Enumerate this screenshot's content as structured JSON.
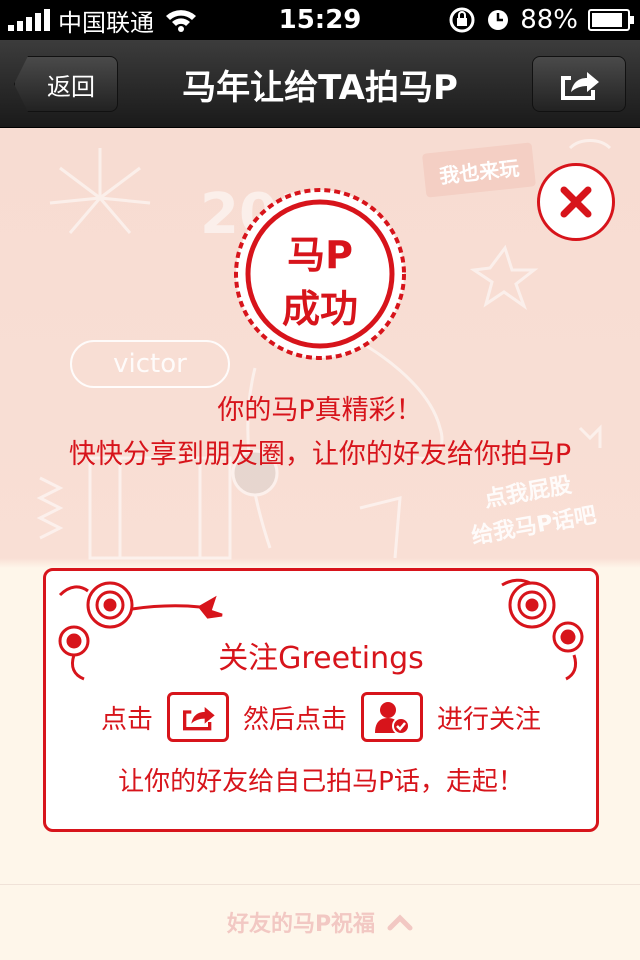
{
  "status_bar": {
    "carrier": "中国联通",
    "time": "15:29",
    "battery": "88%",
    "battery_level": 0.88
  },
  "nav": {
    "back_label": "返回",
    "title": "马年让给TA拍马P",
    "share_icon": "share-icon"
  },
  "background": {
    "play_too": "我也来玩",
    "year": "2014",
    "name_bubble": "victor",
    "poke_line1": "点我屁股",
    "poke_line2": "给我马P话吧"
  },
  "stamp": {
    "line1": "马P",
    "line2": "成功"
  },
  "message": {
    "line1": "你的马P真精彩！",
    "line2": "快快分享到朋友圈，让你的好友给你拍马P"
  },
  "follow_card": {
    "title": "关注Greetings",
    "step1": "点击",
    "step2": "然后点击",
    "step3": "进行关注",
    "footer": "让你的好友给自己拍马P话，走起！"
  },
  "bottom": {
    "blessing_label": "好友的马P祝福"
  },
  "colors": {
    "accent": "#d7141b",
    "background": "#f9dfd5",
    "card": "#ffffff"
  }
}
